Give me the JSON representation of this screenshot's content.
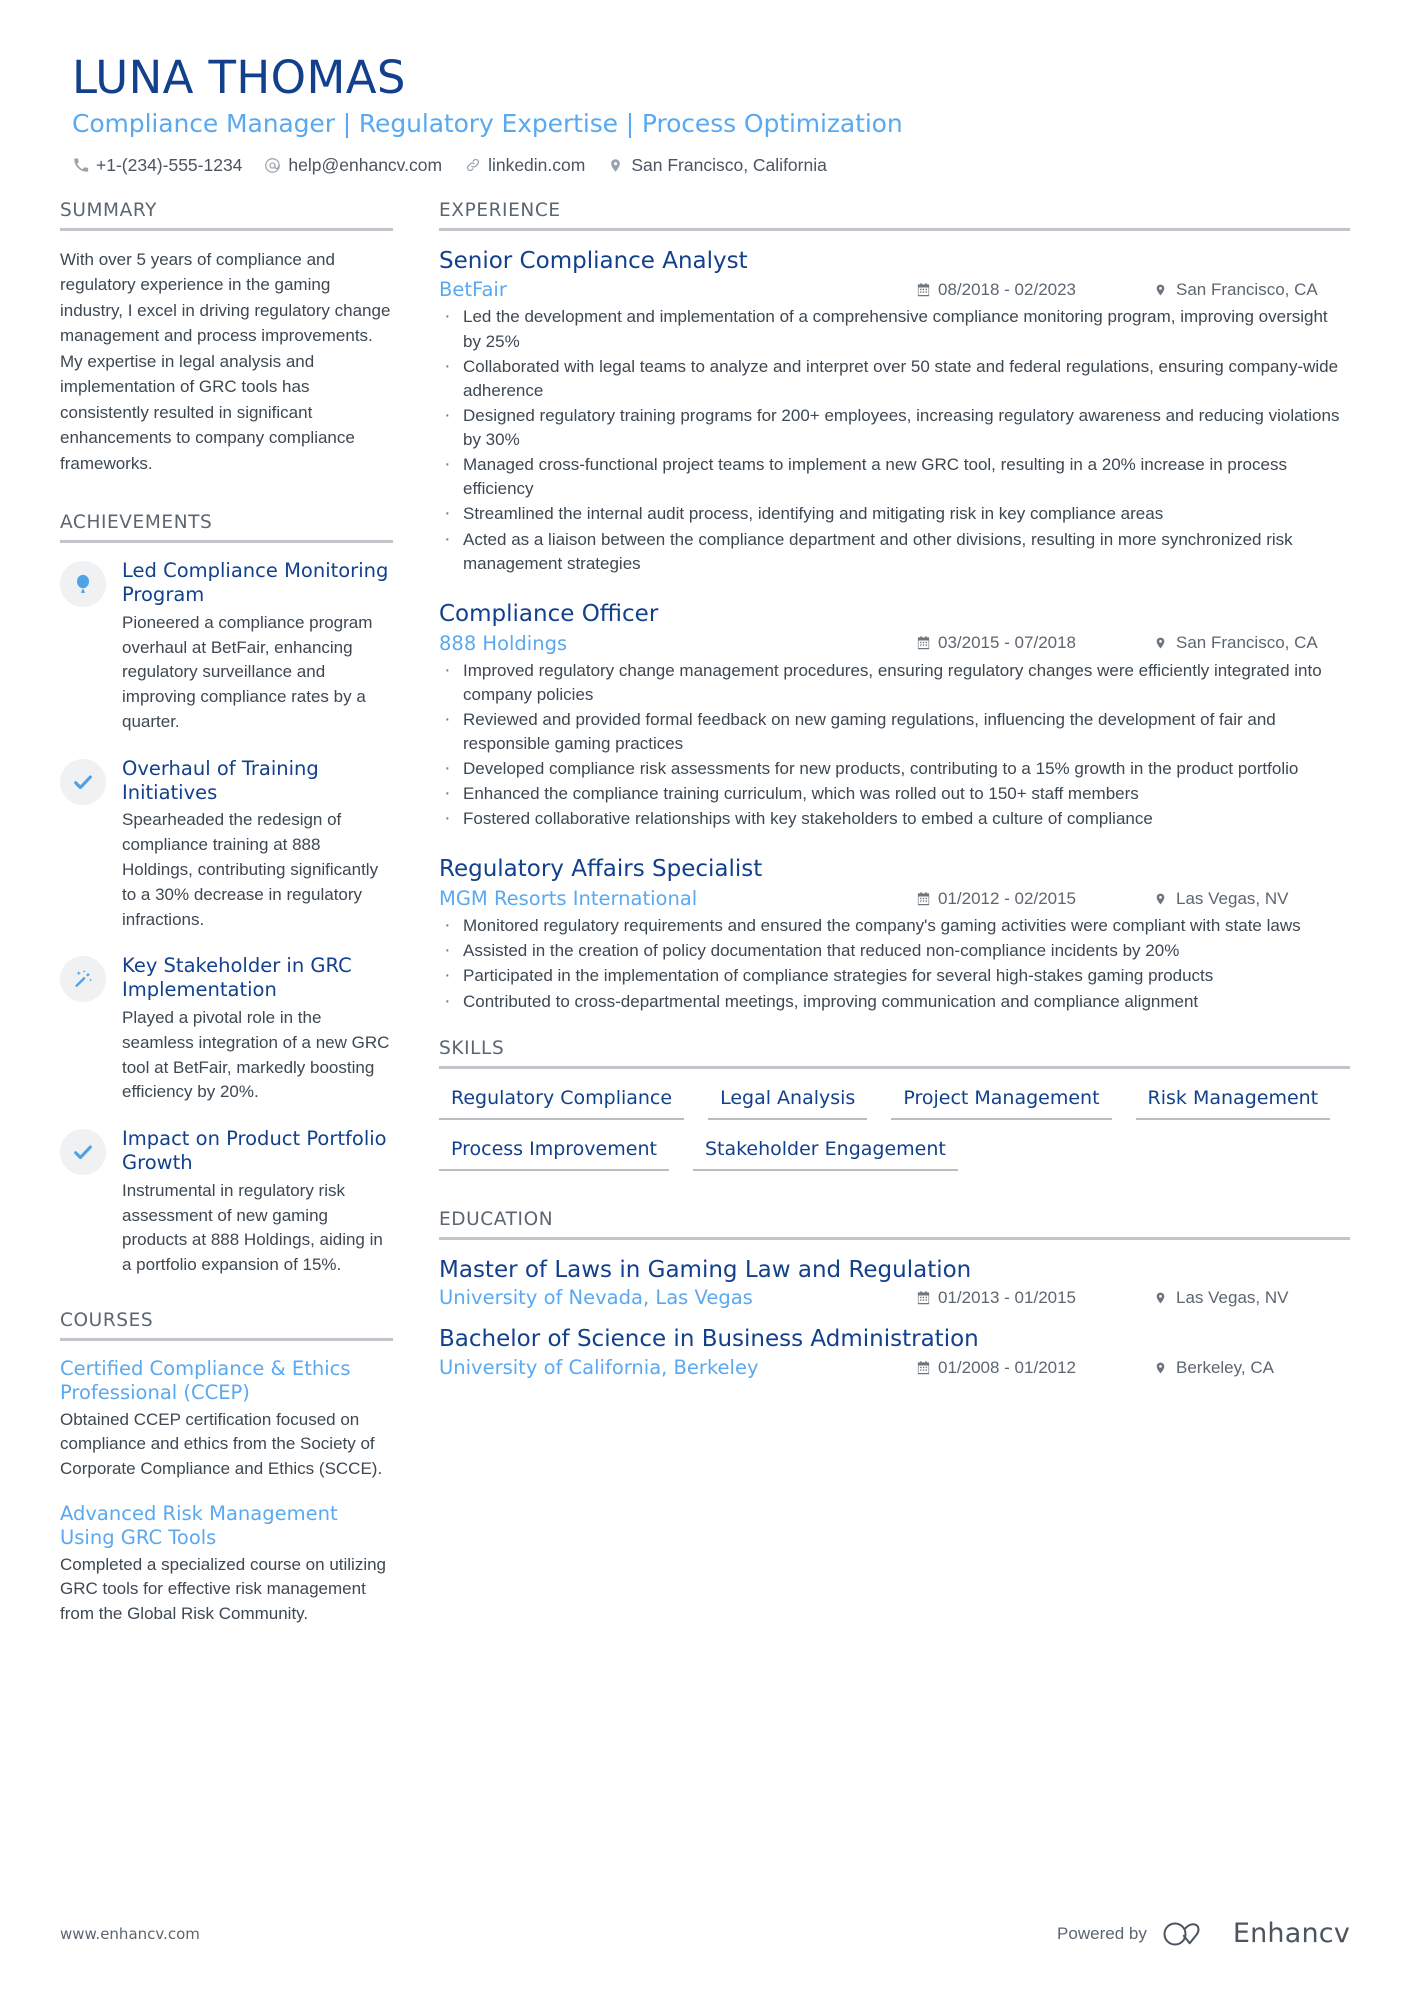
{
  "header": {
    "name": "LUNA THOMAS",
    "headline": "Compliance Manager | Regulatory Expertise | Process Optimization",
    "contacts": [
      {
        "icon": "phone-icon",
        "text": "+1-(234)-555-1234"
      },
      {
        "icon": "email-icon",
        "text": "help@enhancv.com"
      },
      {
        "icon": "link-icon",
        "text": "linkedin.com"
      },
      {
        "icon": "location-icon",
        "text": "San Francisco, California"
      }
    ]
  },
  "colors": {
    "dark_blue": "#12408c",
    "light_blue": "#5aa9f0",
    "body_text": "#3d4852",
    "muted": "#5c6670",
    "rule": "#c2c6cb",
    "badge_bg": "#f0f1f2"
  },
  "summary": {
    "title": "SUMMARY",
    "text": "With over 5 years of compliance and regulatory experience in the gaming industry, I excel in driving regulatory change management and process improvements. My expertise in legal analysis and implementation of GRC tools has consistently resulted in significant enhancements to company compliance frameworks."
  },
  "achievements": {
    "title": "ACHIEVEMENTS",
    "items": [
      {
        "icon": "balloon-icon",
        "title": "Led Compliance Monitoring Program",
        "desc": "Pioneered a compliance program overhaul at BetFair, enhancing regulatory surveillance and improving compliance rates by a quarter."
      },
      {
        "icon": "check-icon",
        "title": "Overhaul of Training Initiatives",
        "desc": "Spearheaded the redesign of compliance training at 888 Holdings, contributing significantly to a 30% decrease in regulatory infractions."
      },
      {
        "icon": "magic-wand-icon",
        "title": "Key Stakeholder in GRC Implementation",
        "desc": "Played a pivotal role in the seamless integration of a new GRC tool at BetFair, markedly boosting efficiency by 20%."
      },
      {
        "icon": "check-icon",
        "title": "Impact on Product Portfolio Growth",
        "desc": "Instrumental in regulatory risk assessment of new gaming products at 888 Holdings, aiding in a portfolio expansion of 15%."
      }
    ]
  },
  "courses": {
    "title": "COURSES",
    "items": [
      {
        "title": "Certified Compliance & Ethics Professional (CCEP)",
        "desc": "Obtained CCEP certification focused on compliance and ethics from the Society of Corporate Compliance and Ethics (SCCE)."
      },
      {
        "title": "Advanced Risk Management Using GRC Tools",
        "desc": "Completed a specialized course on utilizing GRC tools for effective risk management from the Global Risk Community."
      }
    ]
  },
  "experience": {
    "title": "EXPERIENCE",
    "items": [
      {
        "role": "Senior Compliance Analyst",
        "company": "BetFair",
        "dates": "08/2018 - 02/2023",
        "location": "San Francisco, CA",
        "bullets": [
          "Led the development and implementation of a comprehensive compliance monitoring program, improving oversight by 25%",
          "Collaborated with legal teams to analyze and interpret over 50 state and federal regulations, ensuring company-wide adherence",
          "Designed regulatory training programs for 200+ employees, increasing regulatory awareness and reducing violations by 30%",
          "Managed cross-functional project teams to implement a new GRC tool, resulting in a 20% increase in process efficiency",
          "Streamlined the internal audit process, identifying and mitigating risk in key compliance areas",
          "Acted as a liaison between the compliance department and other divisions, resulting in more synchronized risk management strategies"
        ]
      },
      {
        "role": "Compliance Officer",
        "company": "888 Holdings",
        "dates": "03/2015 - 07/2018",
        "location": "San Francisco, CA",
        "bullets": [
          "Improved regulatory change management procedures, ensuring regulatory changes were efficiently integrated into company policies",
          "Reviewed and provided formal feedback on new gaming regulations, influencing the development of fair and responsible gaming practices",
          "Developed compliance risk assessments for new products, contributing to a 15% growth in the product portfolio",
          "Enhanced the compliance training curriculum, which was rolled out to 150+ staff members",
          "Fostered collaborative relationships with key stakeholders to embed a culture of compliance"
        ]
      },
      {
        "role": "Regulatory Affairs Specialist",
        "company": "MGM Resorts International",
        "dates": "01/2012 - 02/2015",
        "location": "Las Vegas, NV",
        "bullets": [
          "Monitored regulatory requirements and ensured the company's gaming activities were compliant with state laws",
          "Assisted in the creation of policy documentation that reduced non-compliance incidents by 20%",
          "Participated in the implementation of compliance strategies for several high-stakes gaming products",
          "Contributed to cross-departmental meetings, improving communication and compliance alignment"
        ]
      }
    ]
  },
  "skills": {
    "title": "SKILLS",
    "items": [
      "Regulatory Compliance",
      "Legal Analysis",
      "Project Management",
      "Risk Management",
      "Process Improvement",
      "Stakeholder Engagement"
    ]
  },
  "education": {
    "title": "EDUCATION",
    "items": [
      {
        "degree": "Master of Laws in Gaming Law and Regulation",
        "school": "University of Nevada, Las Vegas",
        "dates": "01/2013 - 01/2015",
        "location": "Las Vegas, NV"
      },
      {
        "degree": "Bachelor of Science in Business Administration",
        "school": "University of California, Berkeley",
        "dates": "01/2008 - 01/2012",
        "location": "Berkeley, CA"
      }
    ]
  },
  "footer": {
    "url": "www.enhancv.com",
    "powered_by": "Powered by",
    "brand": "Enhancv"
  }
}
